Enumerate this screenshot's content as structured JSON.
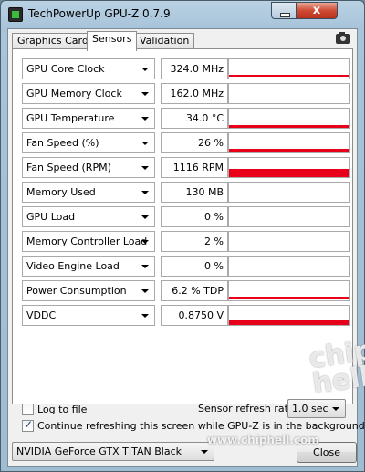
{
  "window": {
    "title": "TechPowerUp GPU-Z 0.7.9",
    "close_glyph": "x"
  },
  "tabs": [
    {
      "label": "Graphics Card",
      "active": false
    },
    {
      "label": "Sensors",
      "active": true
    },
    {
      "label": "Validation",
      "active": false
    }
  ],
  "toolbar": {
    "camera_icon": "camera-icon"
  },
  "sensors": [
    {
      "name": "GPU Core Clock",
      "value": "324.0 MHz",
      "graph_level": 0.04,
      "graph_style": "line"
    },
    {
      "name": "GPU Memory Clock",
      "value": "162.0 MHz",
      "graph_level": 0.0,
      "graph_style": "none"
    },
    {
      "name": "GPU Temperature",
      "value": "34.0 °C",
      "graph_level": 0.12,
      "graph_style": "bar"
    },
    {
      "name": "Fan Speed (%)",
      "value": "26 %",
      "graph_level": 0.2,
      "graph_style": "bar"
    },
    {
      "name": "Fan Speed (RPM)",
      "value": "1116 RPM",
      "graph_level": 0.45,
      "graph_style": "bar"
    },
    {
      "name": "Memory Used",
      "value": "130 MB",
      "graph_level": 0.0,
      "graph_style": "none"
    },
    {
      "name": "GPU Load",
      "value": "0 %",
      "graph_level": 0.0,
      "graph_style": "none"
    },
    {
      "name": "Memory Controller Load",
      "value": "2 %",
      "graph_level": 0.0,
      "graph_style": "none"
    },
    {
      "name": "Video Engine Load",
      "value": "0 %",
      "graph_level": 0.0,
      "graph_style": "none"
    },
    {
      "name": "Power Consumption",
      "value": "6.2 % TDP",
      "graph_level": 0.04,
      "graph_style": "line"
    },
    {
      "name": "VDDC",
      "value": "0.8750 V",
      "graph_level": 0.25,
      "graph_style": "bar"
    }
  ],
  "options": {
    "log_to_file": {
      "label": "Log to file",
      "checked": false
    },
    "continue_refresh": {
      "label": "Continue refreshing this screen while GPU-Z is in the background",
      "checked": true
    },
    "refresh_rate_label": "Sensor refresh rate:",
    "refresh_rate_value": "1.0 sec"
  },
  "footer": {
    "gpu_select": "NVIDIA GeForce GTX TITAN Black",
    "close_label": "Close"
  },
  "watermark": {
    "site": "www.chiphell.com",
    "logo": "chip hell"
  },
  "colors": {
    "graph": "#e8001a",
    "title_bar": "#b9d1e3",
    "close_button": "#cf4b35"
  }
}
